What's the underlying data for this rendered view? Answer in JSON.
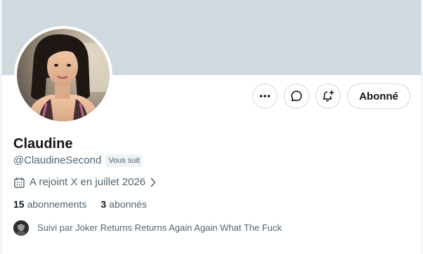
{
  "profile": {
    "name": "Claudine",
    "handle": "@ClaudineSecond",
    "follows_you_badge": "Vous suit",
    "joined": "A rejoint X en juillet 2026",
    "following_count": "15",
    "following_label": "abonnements",
    "followers_count": "3",
    "followers_label": "abonnés",
    "followed_by_text": "Suivi par Joker Returns Returns Again Again What The Fuck"
  },
  "actions": {
    "more_icon": "more-horizontal-icon",
    "message_icon": "message-icon",
    "notify_icon": "bell-plus-icon",
    "follow_label": "Abonné"
  },
  "colors": {
    "banner": "#cfd9de",
    "text_primary": "#0f1419",
    "text_secondary": "#536471",
    "border": "#cfd9de"
  }
}
